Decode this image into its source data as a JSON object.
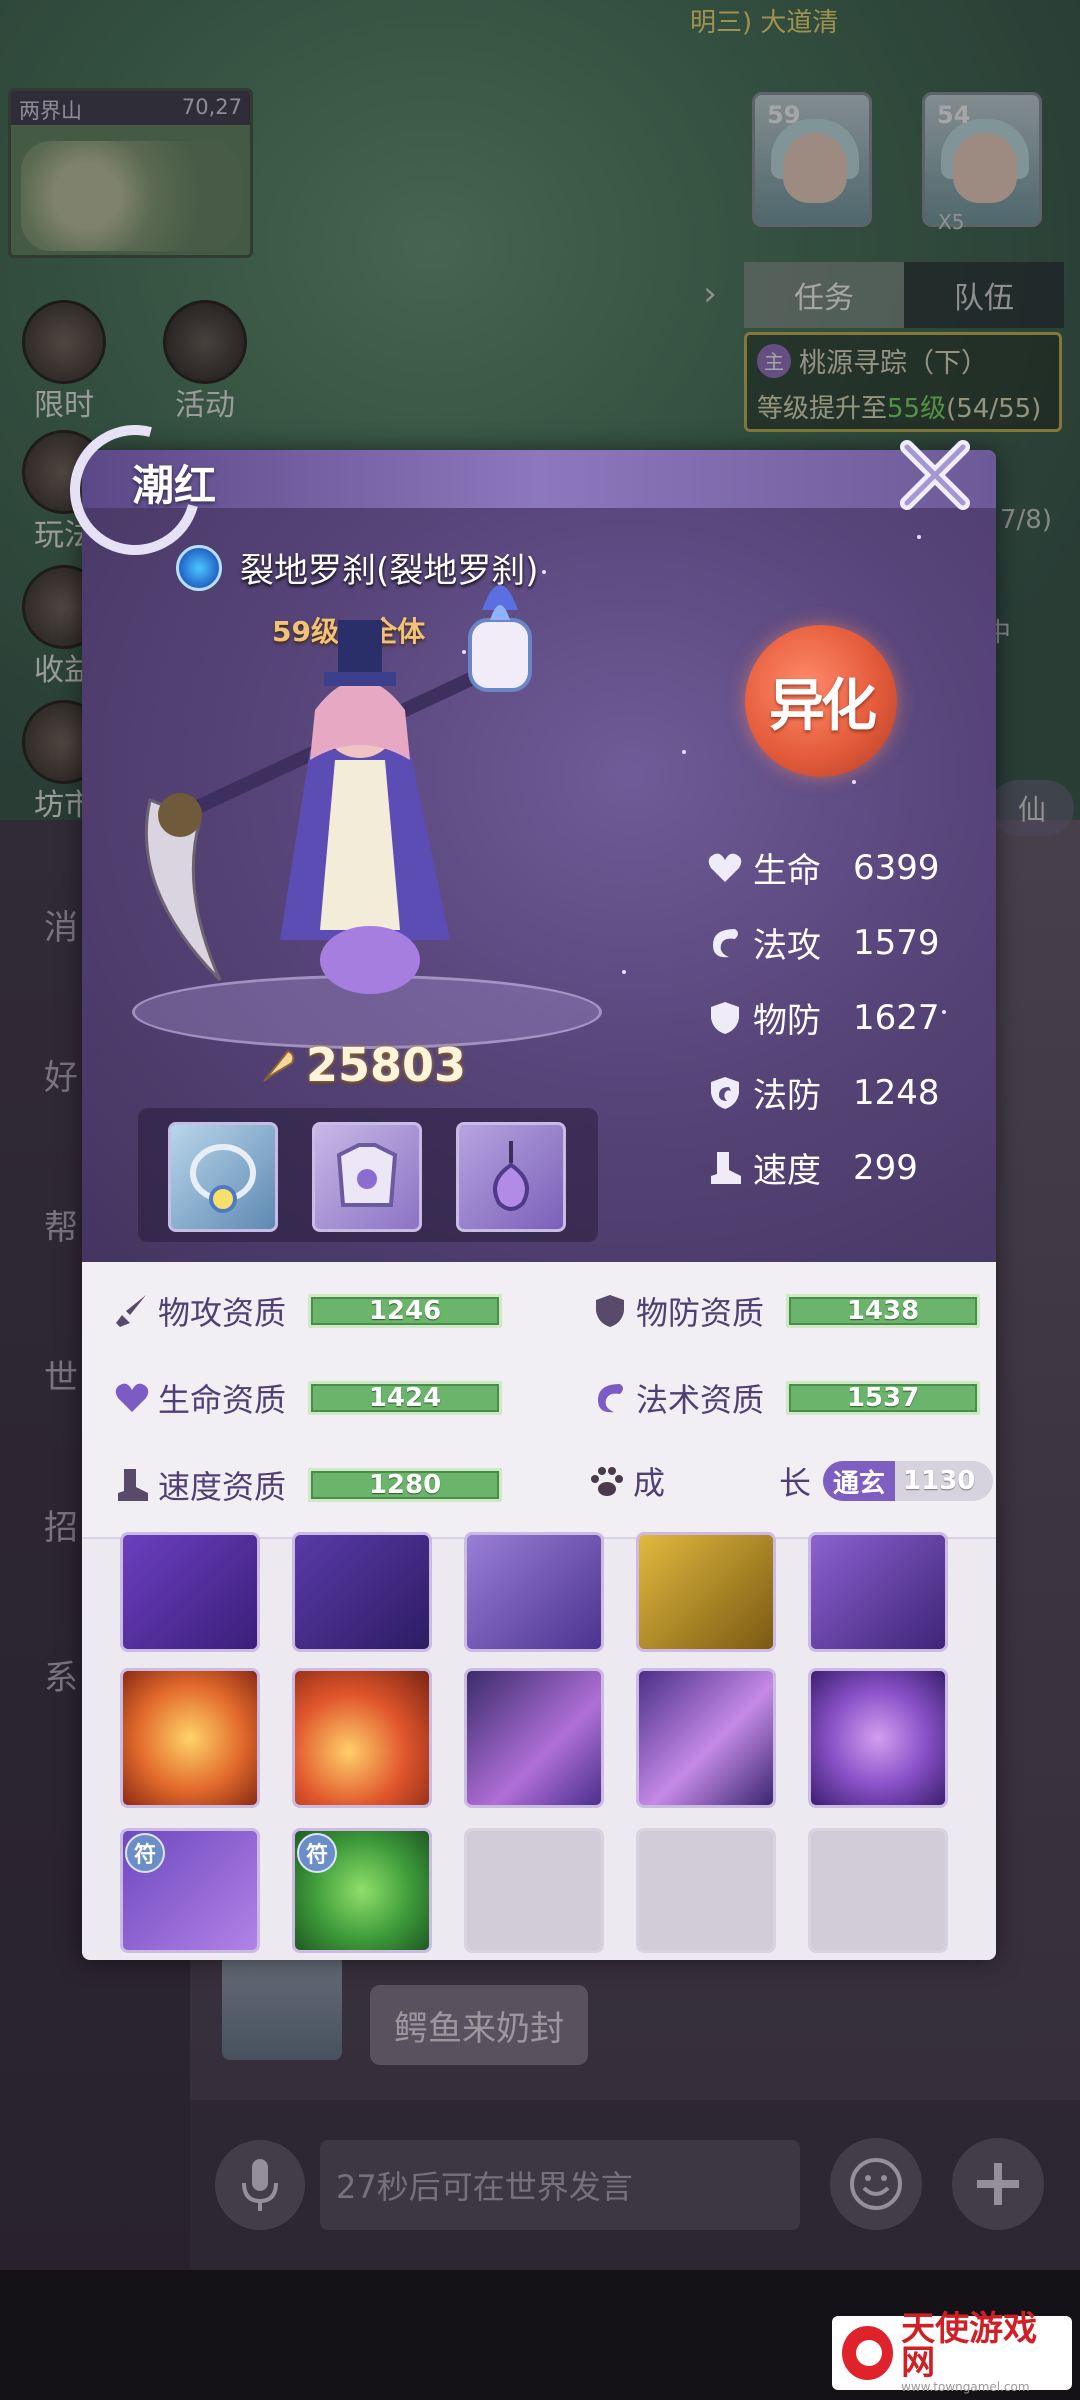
{
  "background": {
    "minimap": {
      "name": "两界山",
      "coords": "70,27"
    },
    "top_text": "明三) 大道清",
    "party_portraits": [
      {
        "level": "59"
      },
      {
        "level": "54",
        "count": "X5"
      }
    ],
    "tabs": [
      "任务",
      "队伍"
    ],
    "quest": {
      "badge": "主",
      "title": "桃源寻踪（下）",
      "desc_prefix": "等级提升至",
      "desc_target": "55级",
      "desc_progress": "(54/55)"
    },
    "side_hints": [
      "7/8)",
      "中"
    ],
    "right_button": "仙",
    "left_menu": [
      "限时",
      "玩法",
      "收益",
      "坊市"
    ],
    "activity_label": "活动",
    "chat_side_labels": [
      "消",
      "好",
      "帮",
      "世",
      "招",
      "系"
    ],
    "chat_message": "鳄鱼来奶封",
    "chat_input_placeholder": "27秒后可在世界发言"
  },
  "panel": {
    "title": "潮红",
    "pet_name": "裂地罗刹(裂地罗刹)",
    "pet_level": "59级 · 全体",
    "variant_badge": "异化",
    "power": "25803",
    "stats": [
      {
        "icon": "heart-icon",
        "label": "生命",
        "value": "6399"
      },
      {
        "icon": "magic-attack-icon",
        "label": "法攻",
        "value": "1579"
      },
      {
        "icon": "shield-icon",
        "label": "物防",
        "value": "1627"
      },
      {
        "icon": "magic-shield-icon",
        "label": "法防",
        "value": "1248"
      },
      {
        "icon": "boot-icon",
        "label": "速度",
        "value": "299"
      }
    ],
    "aptitudes": [
      {
        "icon": "sword-icon",
        "label": "物攻资质",
        "value": "1246"
      },
      {
        "icon": "shield-icon",
        "label": "物防资质",
        "value": "1438"
      },
      {
        "icon": "heart-icon",
        "label": "生命资质",
        "value": "1424"
      },
      {
        "icon": "magic-icon",
        "label": "法术资质",
        "value": "1537"
      },
      {
        "icon": "boot-icon",
        "label": "速度资质",
        "value": "1280"
      }
    ],
    "growth": {
      "label_a": "成",
      "label_b": "长",
      "tier": "通玄",
      "value": "1130"
    },
    "rune_mark": "符"
  },
  "watermark": {
    "text": "天使游戏网",
    "url": "www.towngamel.com"
  }
}
